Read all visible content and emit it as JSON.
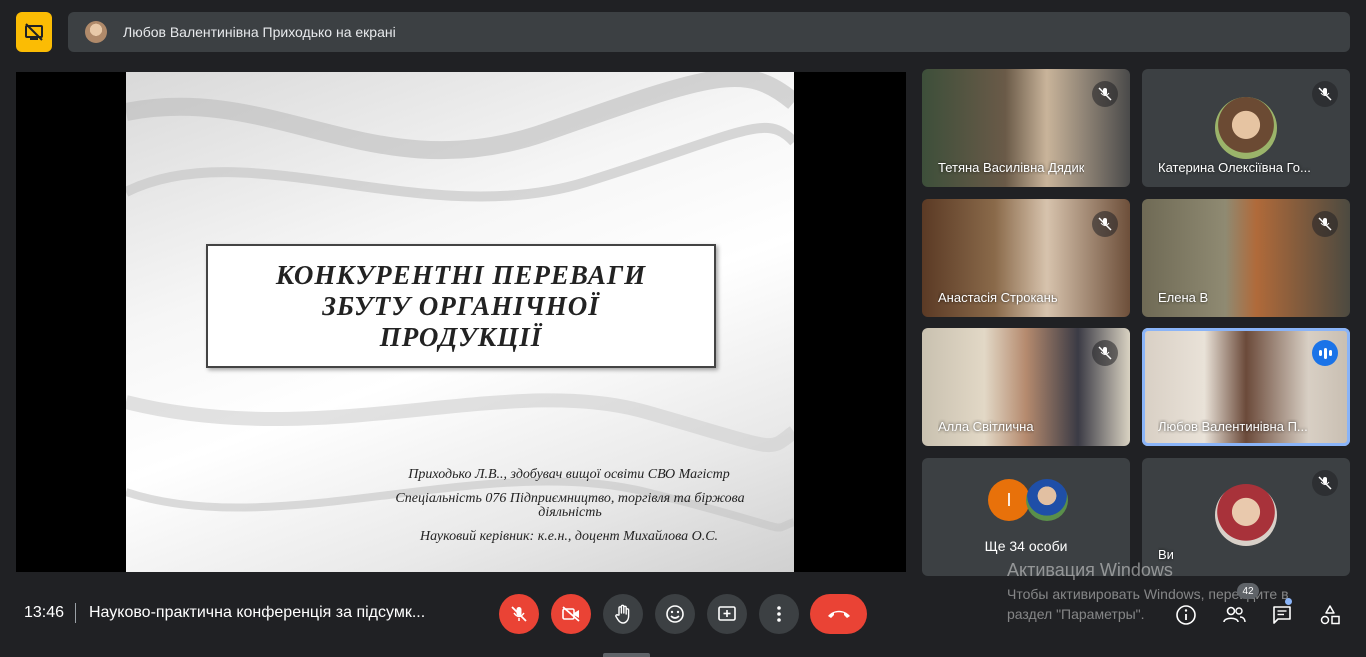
{
  "banner": {
    "text": "Любов Валентинівна Приходько на екрані"
  },
  "slide": {
    "title": "КОНКУРЕНТНІ ПЕРЕВАГИ ЗБУТУ ОРГАНІЧНОЇ ПРОДУКЦІЇ",
    "line1": "Приходько Л.В.., здобувач вищої освіти СВО Магістр",
    "line2": "Спеціальність 076 Підприємництво, торгівля та біржова діяльність",
    "line3": "Науковий керівник: к.е.н., доцент Михайлова О.С."
  },
  "participants": [
    {
      "name": "Тетяна Василівна Дядик",
      "muted": true
    },
    {
      "name": "Катерина Олексіївна Го...",
      "muted": true
    },
    {
      "name": "Анастасія Строкань",
      "muted": true
    },
    {
      "name": "Елена В",
      "muted": true
    },
    {
      "name": "Алла Світлична",
      "muted": true
    },
    {
      "name": "Любов Валентинівна П...",
      "muted": false,
      "speaking": true
    },
    {
      "name": "Ще 34 особи",
      "avatar_letter": "I"
    },
    {
      "name": "Ви",
      "muted": true
    }
  ],
  "bottom": {
    "time": "13:46",
    "meeting_title": "Науково-практична конференція за підсумк...",
    "participants_count": "42"
  },
  "watermark": {
    "title": "Активация Windows",
    "text": "Чтобы активировать Windows, перейдите в раздел \"Параметры\"."
  },
  "colors": {
    "accent": "#8ab4f8",
    "danger": "#ea4335",
    "warning": "#fbbc04",
    "surface": "#3c4043"
  }
}
